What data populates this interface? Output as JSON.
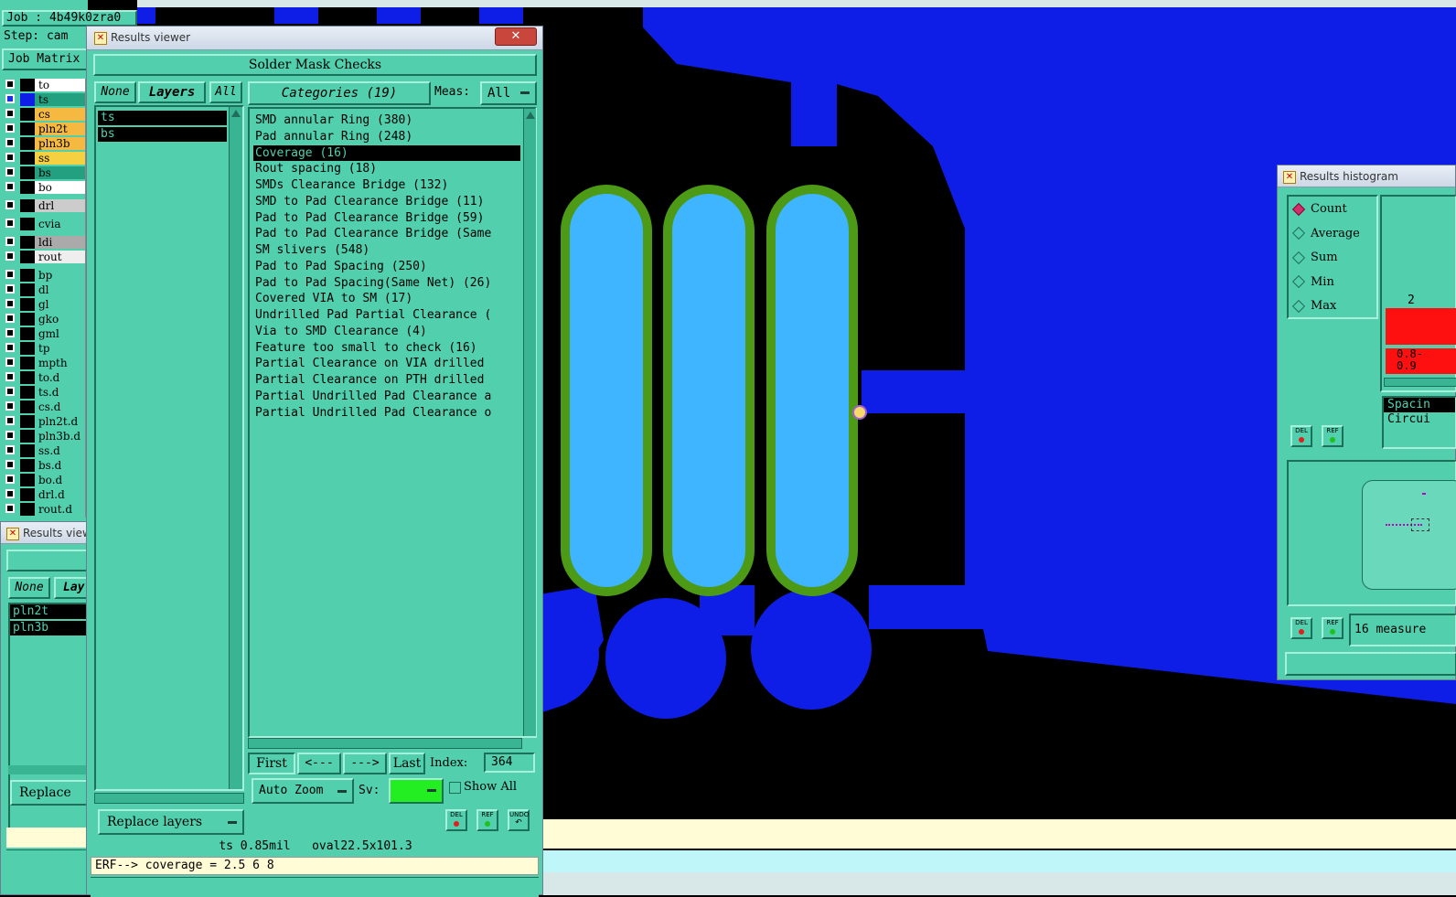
{
  "job_label": "Job : 4b49k0zra0",
  "step_label": "Step: cam",
  "job_matrix_label": "Job Matrix",
  "layers": [
    {
      "name": "to",
      "color": "#ffffff",
      "checked": false
    },
    {
      "name": "ts",
      "color": "#22a080",
      "checked": true
    },
    {
      "name": "cs",
      "color": "#f5b942",
      "checked": false
    },
    {
      "name": "pln2t",
      "color": "#f5b942",
      "checked": false
    },
    {
      "name": "pln3b",
      "color": "#f5b942",
      "checked": false
    },
    {
      "name": "ss",
      "color": "#f5d040",
      "checked": false
    },
    {
      "name": "bs",
      "color": "#22a080",
      "checked": false
    },
    {
      "name": "bo",
      "color": "#ffffff",
      "checked": false
    },
    {
      "name": "drl",
      "color": "#cccccc",
      "checked": false
    },
    {
      "name": "cvia",
      "color": "#52cfad",
      "checked": false
    },
    {
      "name": "ldi",
      "color": "#aaaaaa",
      "checked": false
    },
    {
      "name": "rout",
      "color": "#eeeeee",
      "checked": false
    },
    {
      "name": "bp",
      "color": "#52cfad",
      "checked": false
    },
    {
      "name": "dl",
      "color": "#52cfad",
      "checked": false
    },
    {
      "name": "gl",
      "color": "#52cfad",
      "checked": false
    },
    {
      "name": "gko",
      "color": "#52cfad",
      "checked": false
    },
    {
      "name": "gml",
      "color": "#52cfad",
      "checked": false
    },
    {
      "name": "tp",
      "color": "#52cfad",
      "checked": false
    },
    {
      "name": "mpth",
      "color": "#52cfad",
      "checked": false
    },
    {
      "name": "to.d",
      "color": "#52cfad",
      "checked": false
    },
    {
      "name": "ts.d",
      "color": "#52cfad",
      "checked": false
    },
    {
      "name": "cs.d",
      "color": "#52cfad",
      "checked": false
    },
    {
      "name": "pln2t.d",
      "color": "#52cfad",
      "checked": false
    },
    {
      "name": "pln3b.d",
      "color": "#52cfad",
      "checked": false
    },
    {
      "name": "ss.d",
      "color": "#52cfad",
      "checked": false
    },
    {
      "name": "bs.d",
      "color": "#52cfad",
      "checked": false
    },
    {
      "name": "bo.d",
      "color": "#52cfad",
      "checked": false
    },
    {
      "name": "drl.d",
      "color": "#52cfad",
      "checked": false
    },
    {
      "name": "rout.d",
      "color": "#52cfad",
      "checked": false
    }
  ],
  "back_viewer": {
    "title": "Results view",
    "none_label": "None",
    "layers_label": "Lay",
    "layers": [
      "pln2t",
      "pln3b"
    ],
    "replace_label": "Replace"
  },
  "viewer": {
    "title": "Results viewer",
    "header": "Solder Mask Checks",
    "none_label": "None",
    "layers_label": "Layers",
    "all_label": "All",
    "categories_label": "Categories (19)",
    "meas_label": "Meas:",
    "meas_value": "All",
    "layers": [
      "ts",
      "bs"
    ],
    "categories": [
      "SMD annular Ring (380)",
      "Pad annular Ring (248)",
      "Coverage (16)",
      "Rout spacing (18)",
      "SMDs Clearance Bridge (132)",
      "SMD to Pad Clearance Bridge (11)",
      "Pad to Pad Clearance Bridge (59)",
      "Pad to Pad Clearance Bridge (Same",
      "SM slivers (548)",
      "Pad to Pad Spacing (250)",
      "Pad to Pad Spacing(Same Net) (26)",
      "Covered VIA to SM (17)",
      "Undrilled Pad Partial Clearance (",
      "Via to SMD Clearance (4)",
      "Feature too small to check (16)",
      "Partial Clearance on VIA drilled",
      "Partial Clearance on PTH drilled",
      "Partial Undrilled Pad Clearance a",
      "Partial Undrilled Pad Clearance o"
    ],
    "selected_category": 2,
    "first_label": "First",
    "prev_label": "<---",
    "next_label": "--->",
    "last_label": "Last",
    "index_label": "Index:",
    "index_value": "364",
    "auto_zoom_label": "Auto Zoom",
    "sv_label": "Sv:",
    "show_all_label": "Show All",
    "replace_layers_label": "Replace layers",
    "del_label": "DEL",
    "ref_label": "REF",
    "undo_label": "UNDO",
    "status_line": "ts 0.85mil   oval22.5x101.3",
    "erf_line": "ERF--> coverage = 2.5 6 8"
  },
  "histogram": {
    "title": "Results histogram",
    "options": [
      "Count",
      "Average",
      "Sum",
      "Min",
      "Max"
    ],
    "selected": 0,
    "bar_count_label": "2",
    "bar_range_label": "0.8-\n0.9",
    "side_lines": [
      "Spacin",
      "Circui"
    ],
    "del_label": "DEL",
    "ref_label": "REF",
    "measure_text": "16 measure"
  },
  "colors": {
    "panel": "#52cfad",
    "pcb_blue": "#0f1ee6",
    "pad_fill": "#3fb4ff",
    "pad_outline": "#4c9a16",
    "sv_green": "#22ee22"
  }
}
